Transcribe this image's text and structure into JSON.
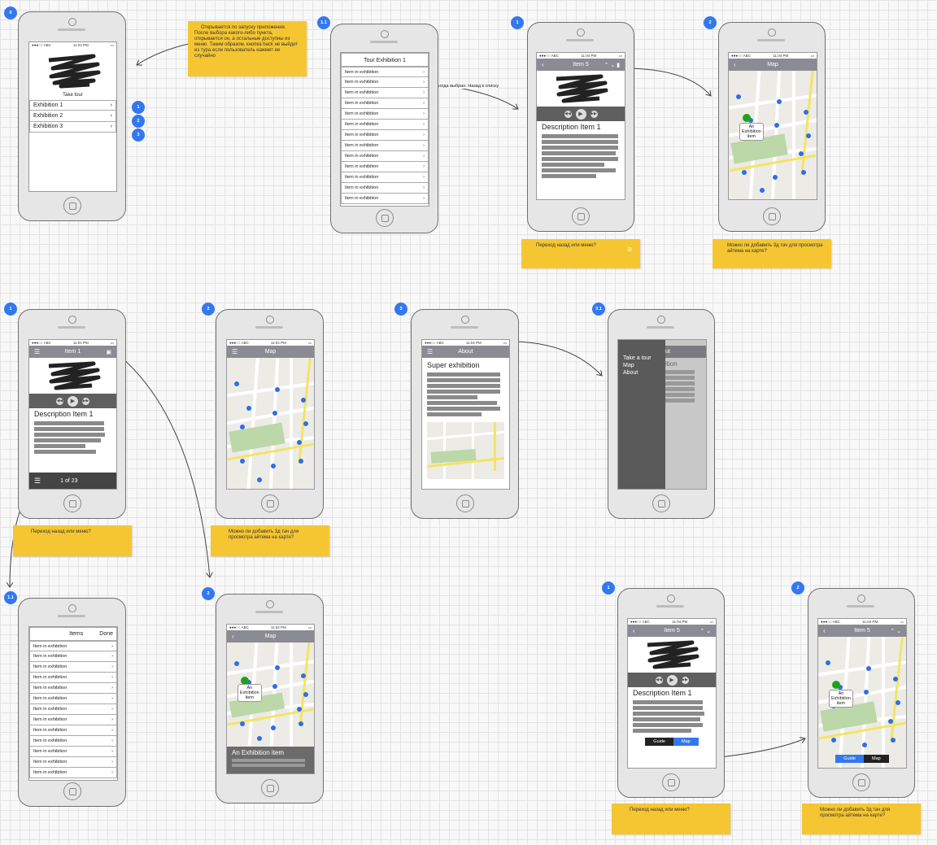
{
  "status": {
    "carrier": "●●●○○ ABC",
    "time": "11:04 PM",
    "battery": "▭"
  },
  "badges": {
    "b0": "0",
    "b11": "1.1",
    "b1": "1",
    "b2": "2",
    "b3": "3",
    "b31": "3.1"
  },
  "s0": {
    "take_tour": "Take tour",
    "items": [
      "Exhibition 1",
      "Exhibition 2",
      "Exhibition 3"
    ]
  },
  "note0": {
    "bullet": "Открывается по запуску приложения.",
    "text": "После выбора какого-либо пункта, открывается он, а остальные доступны из меню. Таким образом, кнопка back не выйдет из тура если пользователь нажмет ее случайно"
  },
  "s11": {
    "title": "Tour Exhibition 1",
    "items": [
      "Item in exhibition",
      "Item in exhibition",
      "Item in exhibition",
      "Item in exhibition",
      "Item in exhibition",
      "Item in exhibition",
      "Item in exhibition",
      "Item in exhibition",
      "Item in exhibition",
      "Item in exhibition",
      "Item in exhibition",
      "Item in exhibition",
      "Item in exhibition"
    ]
  },
  "arrow_label": "когда выбран. Назад к списку",
  "item5": {
    "title": "Item 5",
    "desc": "Description Item 1"
  },
  "notes": {
    "back_menu": "Переход назад или меню?",
    "touch3d": "Можно ли добавить 3д тач для просмотра айтема на карте?"
  },
  "map": {
    "title": "Map",
    "tip": "An Exhibition item"
  },
  "item1": {
    "title": "Item 1",
    "desc": "Description Item 1",
    "pager": "1 of 23"
  },
  "about": {
    "title": "About",
    "heading": "Super exhibition"
  },
  "menu": {
    "items": [
      "Take a tour",
      "Map",
      "About"
    ],
    "behind_title": "ut",
    "behind_heading": "ition"
  },
  "list2": {
    "title": "Items",
    "done": "Done"
  },
  "mapdetail": {
    "title": "An Exhibition item"
  },
  "seg": {
    "guide": "Guide",
    "map": "Map"
  }
}
